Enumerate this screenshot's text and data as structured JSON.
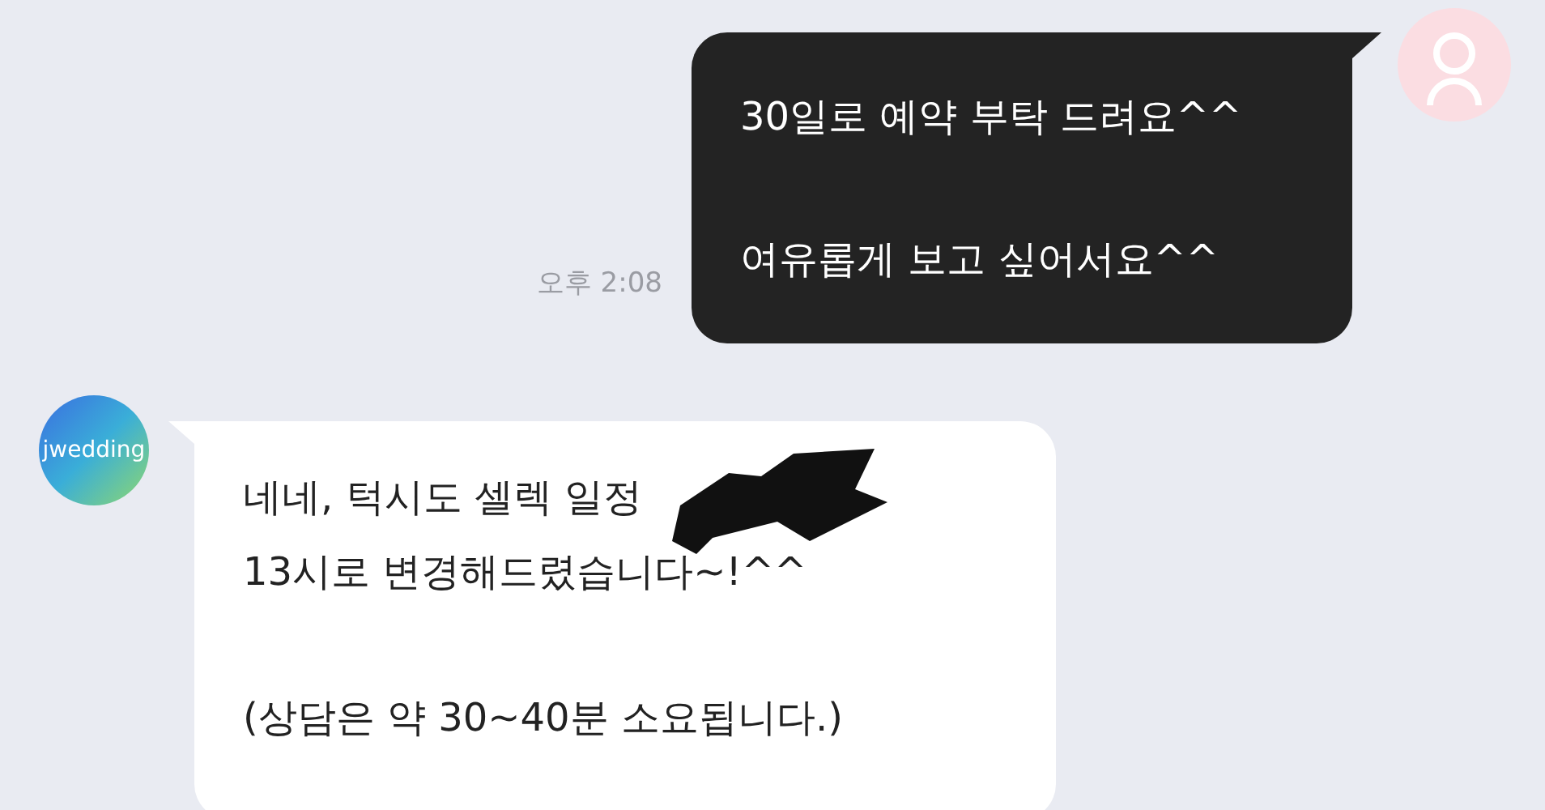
{
  "messages": [
    {
      "kind": "sent",
      "paragraphs": [
        [
          "30일로 예약 부탁 드려요^^"
        ],
        [
          "여유롭게 보고 싶어서요^^"
        ]
      ],
      "time": "오후 2:08"
    },
    {
      "kind": "received",
      "sender_logo": "jwedding",
      "paragraphs": [
        [
          "네네, 턱시도 셀렉 일정",
          "13시로 변경해드렸습니다~!^^"
        ],
        [
          "(상담은 약 30~40분 소요됩니다.)"
        ]
      ],
      "redacted": true
    }
  ]
}
